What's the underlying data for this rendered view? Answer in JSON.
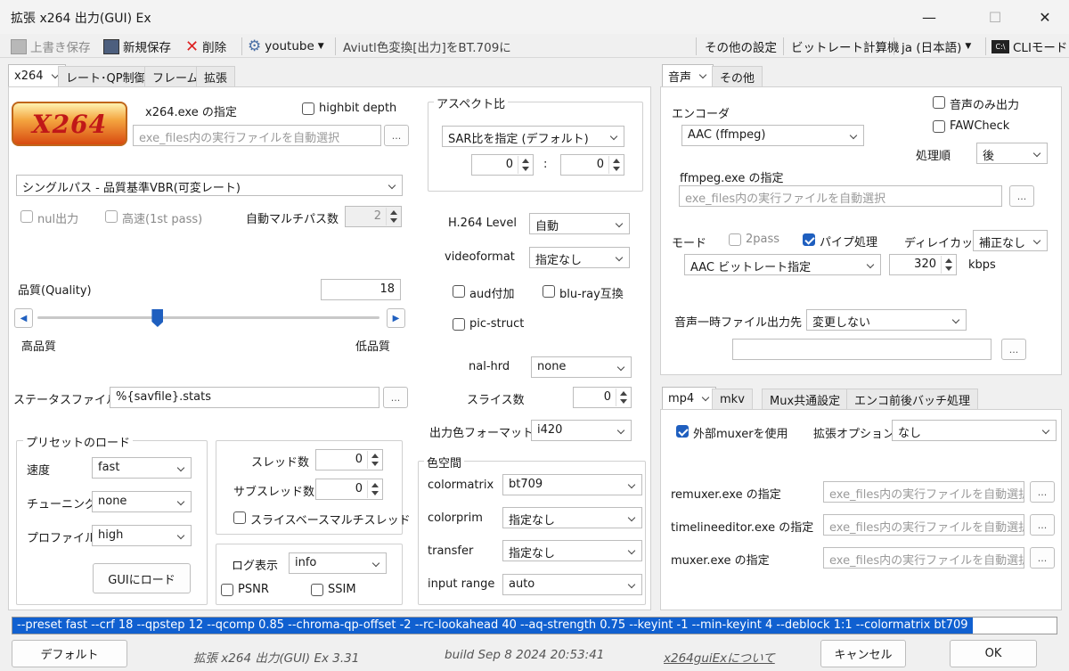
{
  "window": {
    "title": "拡張 x264 出力(GUI) Ex",
    "minimize": "—",
    "maximize": "☐",
    "close": "✕"
  },
  "toolbar": {
    "overwrite_save": "上書き保存",
    "new_save": "新規保存",
    "delete": "削除",
    "profile": "youtube",
    "aviutl_convert": "Aviutl色変換[出力]をBT.709に",
    "other_settings": "その他の設定",
    "bitrate_calc": "ビットレート計算機",
    "language": "ja (日本語)",
    "cli_mode": "CLIモード",
    "cli_icon_text": "C:\\"
  },
  "left_tabs": [
    "x264",
    "レート･QP制御",
    "フレーム",
    "拡張"
  ],
  "x264": {
    "logo_text": "X264",
    "exe_label": "x264.exe の指定",
    "highbit_label": "highbit depth",
    "exe_placeholder": "exe_files内の実行ファイルを自動選択",
    "browse": "...",
    "mode_select": "シングルパス - 品質基準VBR(可変レート)",
    "nul_out": "nul出力",
    "fast_1st": "高速(1st pass)",
    "auto_multipass": "自動マルチパス数",
    "multipass_value": "2",
    "quality_label": "品質(Quality)",
    "quality_value": "18",
    "quality_fraction": 0.35,
    "high_quality": "高品質",
    "low_quality": "低品質",
    "status_file_label": "ステータスファイル",
    "status_file_value": "%{savfile}.stats",
    "preset_group": "プリセットのロード",
    "speed_label": "速度",
    "speed_value": "fast",
    "tuning_label": "チューニング",
    "tuning_value": "none",
    "profile_label": "プロファイル",
    "profile_value": "high",
    "gui_load": "GUIにロード",
    "threads_label": "スレッド数",
    "threads_value": "0",
    "subthreads_label": "サブスレッド数",
    "subthreads_value": "0",
    "slice_multithread": "スライスベースマルチスレッド",
    "log_label": "ログ表示",
    "log_value": "info",
    "psnr": "PSNR",
    "ssim": "SSIM",
    "aspect_group": "アスペクト比",
    "aspect_select": "SAR比を指定 (デフォルト)",
    "aspect_w": "0",
    "aspect_sep": ":",
    "aspect_h": "0",
    "h264_level_label": "H.264 Level",
    "h264_level_value": "自動",
    "videoformat_label": "videoformat",
    "videoformat_value": "指定なし",
    "aud": "aud付加",
    "bluray": "blu-ray互換",
    "pic_struct": "pic-struct",
    "nal_hrd_label": "nal-hrd",
    "nal_hrd_value": "none",
    "slices_label": "スライス数",
    "slices_value": "0",
    "out_csp_label": "出力色フォーマット",
    "out_csp_value": "i420",
    "colorspace_group": "色空間",
    "colormatrix_label": "colormatrix",
    "colormatrix_value": "bt709",
    "colorprim_label": "colorprim",
    "colorprim_value": "指定なし",
    "transfer_label": "transfer",
    "transfer_value": "指定なし",
    "input_range_label": "input range",
    "input_range_value": "auto"
  },
  "audio_tabs": [
    "音声",
    "その他"
  ],
  "audio": {
    "encoder_label": "エンコーダ",
    "encoder_value": "AAC (ffmpeg)",
    "audio_only": "音声のみ出力",
    "fawcheck": "FAWCheck",
    "order_label": "処理順",
    "order_value": "後",
    "exe_label": "ffmpeg.exe の指定",
    "exe_placeholder": "exe_files内の実行ファイルを自動選択",
    "browse": "...",
    "mode_label": "モード",
    "twopass": "2pass",
    "pipe": "パイプ処理",
    "delay_label": "ディレイカット",
    "delay_value": "補正なし",
    "mode_value": "AAC ビットレート指定",
    "bitrate_value": "320",
    "bitrate_unit": "kbps",
    "temp_label": "音声一時ファイル出力先",
    "temp_value": "変更しない",
    "temp_path": ""
  },
  "mux_tabs": [
    "mp4",
    "mkv",
    "Mux共通設定",
    "エンコ前後バッチ処理"
  ],
  "mux": {
    "external": "外部muxerを使用",
    "ext_option_label": "拡張オプション",
    "ext_option_value": "なし",
    "remuxer_label": "remuxer.exe の指定",
    "timeline_label": "timelineeditor.exe の指定",
    "muxer_label": "muxer.exe の指定",
    "placeholder": "exe_files内の実行ファイルを自動選択",
    "browse": "..."
  },
  "cmdline": "--preset fast --crf 18 --qpstep 12 --qcomp 0.85 --chroma-qp-offset -2 --rc-lookahead 40 --aq-strength 0.75 --keyint -1 --min-keyint 4 --deblock 1:1 --colormatrix bt709",
  "footer": {
    "default": "デフォルト",
    "version": "拡張 x264 出力(GUI) Ex 3.31",
    "build": "build Sep  8 2024 20:53:41",
    "about": "x264guiExについて",
    "cancel": "キャンセル",
    "ok": "OK"
  },
  "colors": {
    "accent": "#1f5fbf",
    "selection": "#1060d0"
  }
}
